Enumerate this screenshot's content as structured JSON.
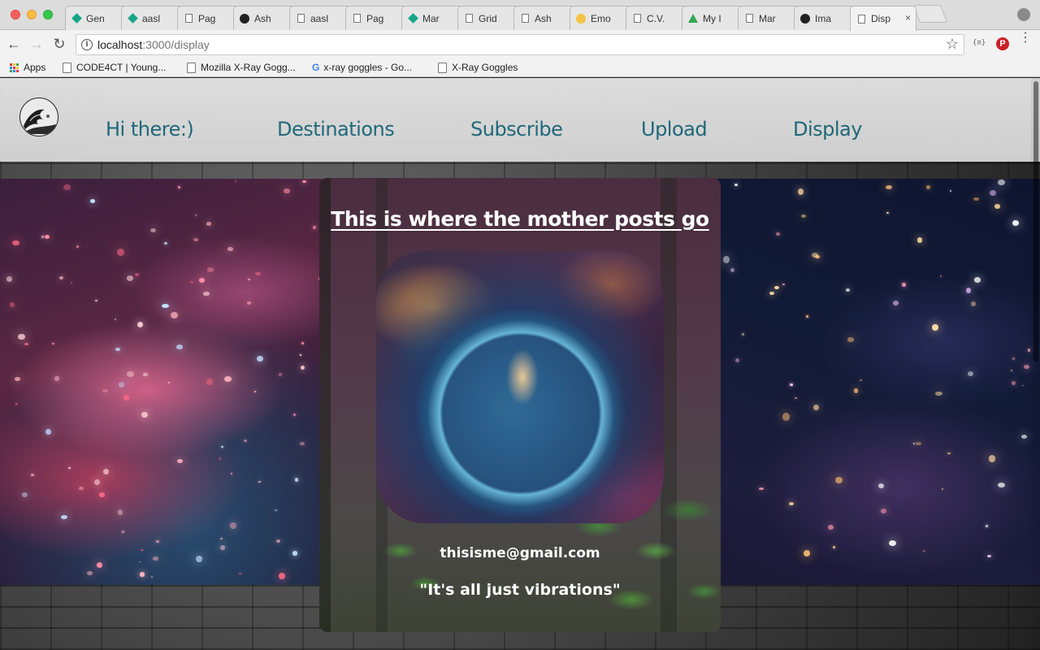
{
  "browser": {
    "tabs": [
      {
        "title": "Gen",
        "icon": "teal-diamond-icon",
        "active": false
      },
      {
        "title": "aasl",
        "icon": "teal-diamond-icon",
        "active": false
      },
      {
        "title": "Pag",
        "icon": "page-icon",
        "active": false
      },
      {
        "title": "Ash",
        "icon": "github-icon",
        "active": false
      },
      {
        "title": "aasl",
        "icon": "page-icon",
        "active": false
      },
      {
        "title": "Pag",
        "icon": "page-icon",
        "active": false
      },
      {
        "title": "Mar",
        "icon": "teal-diamond-icon",
        "active": false
      },
      {
        "title": "Grid",
        "icon": "page-icon",
        "active": false
      },
      {
        "title": "Ash",
        "icon": "page-icon",
        "active": false
      },
      {
        "title": "Emo",
        "icon": "emoji-icon",
        "active": false
      },
      {
        "title": "C.V.",
        "icon": "page-icon",
        "active": false
      },
      {
        "title": "My I",
        "icon": "drive-icon",
        "active": false
      },
      {
        "title": "Mar",
        "icon": "page-icon",
        "active": false
      },
      {
        "title": "Ima",
        "icon": "github-icon",
        "active": false
      },
      {
        "title": "Disp",
        "icon": "page-icon",
        "active": true
      }
    ],
    "tab_close_glyph": "×",
    "address": {
      "host": "localhost",
      "path": ":3000/display"
    },
    "bookmarks": {
      "apps_label": "Apps",
      "items": [
        "CODE4CT | Young...",
        "Mozilla X-Ray Gogg...",
        "x-ray goggles - Go...",
        "X-Ray Goggles"
      ]
    },
    "extension_json_label": "{≡}",
    "pinterest_label": "P"
  },
  "site": {
    "nav": [
      "Hi there:)",
      "Destinations",
      "Subscribe",
      "Upload",
      "Display"
    ],
    "card": {
      "title": "This is where the mother posts go",
      "email": "thisisme@gmail.com",
      "quote": "\"It's all just vibrations\""
    }
  },
  "colors": {
    "nav_link": "#1d6a7c",
    "card_text": "#ffffff"
  }
}
